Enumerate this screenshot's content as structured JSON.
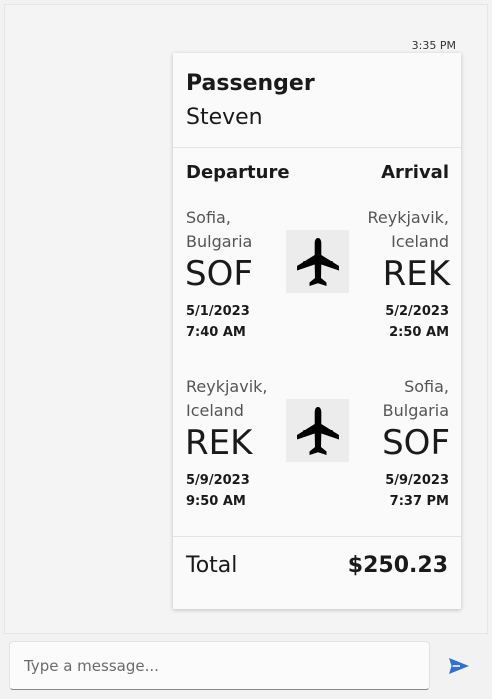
{
  "message": {
    "timestamp": "3:35 PM"
  },
  "card": {
    "passenger_label": "Passenger",
    "passenger_name": "Steven",
    "departure_header": "Departure",
    "arrival_header": "Arrival",
    "legs": [
      {
        "from_city": "Sofia,",
        "from_country": "Bulgaria",
        "from_code": "SOF",
        "from_date": "5/1/2023",
        "from_time": "7:40 AM",
        "to_city": "Reykjavik,",
        "to_country": "Iceland",
        "to_code": "REK",
        "to_date": "5/2/2023",
        "to_time": "2:50 AM"
      },
      {
        "from_city": "Reykjavik,",
        "from_country": "Iceland",
        "from_code": "REK",
        "from_date": "5/9/2023",
        "from_time": "9:50 AM",
        "to_city": "Sofia,",
        "to_country": "Bulgaria",
        "to_code": "SOF",
        "to_date": "5/9/2023",
        "to_time": "7:37 PM"
      }
    ],
    "total_label": "Total",
    "total_value": "$250.23"
  },
  "composer": {
    "placeholder": "Type a message..."
  },
  "icons": {
    "leg_icon": "airplane-icon",
    "send_icon": "send-icon"
  },
  "colors": {
    "send_accent": "#2f6fd6"
  }
}
